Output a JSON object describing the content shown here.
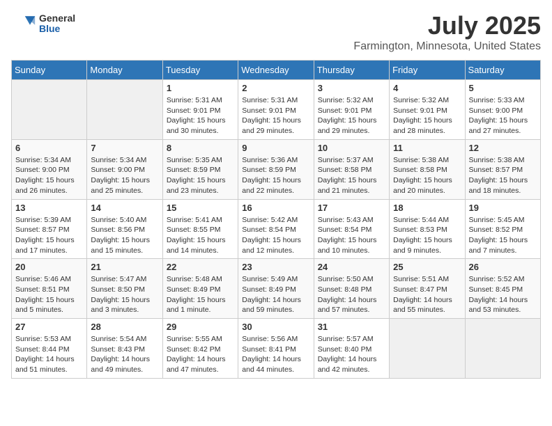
{
  "header": {
    "logo_general": "General",
    "logo_blue": "Blue",
    "title": "July 2025",
    "subtitle": "Farmington, Minnesota, United States"
  },
  "calendar": {
    "days_of_week": [
      "Sunday",
      "Monday",
      "Tuesday",
      "Wednesday",
      "Thursday",
      "Friday",
      "Saturday"
    ],
    "weeks": [
      [
        {
          "day": "",
          "info": ""
        },
        {
          "day": "",
          "info": ""
        },
        {
          "day": "1",
          "info": "Sunrise: 5:31 AM\nSunset: 9:01 PM\nDaylight: 15 hours\nand 30 minutes."
        },
        {
          "day": "2",
          "info": "Sunrise: 5:31 AM\nSunset: 9:01 PM\nDaylight: 15 hours\nand 29 minutes."
        },
        {
          "day": "3",
          "info": "Sunrise: 5:32 AM\nSunset: 9:01 PM\nDaylight: 15 hours\nand 29 minutes."
        },
        {
          "day": "4",
          "info": "Sunrise: 5:32 AM\nSunset: 9:01 PM\nDaylight: 15 hours\nand 28 minutes."
        },
        {
          "day": "5",
          "info": "Sunrise: 5:33 AM\nSunset: 9:00 PM\nDaylight: 15 hours\nand 27 minutes."
        }
      ],
      [
        {
          "day": "6",
          "info": "Sunrise: 5:34 AM\nSunset: 9:00 PM\nDaylight: 15 hours\nand 26 minutes."
        },
        {
          "day": "7",
          "info": "Sunrise: 5:34 AM\nSunset: 9:00 PM\nDaylight: 15 hours\nand 25 minutes."
        },
        {
          "day": "8",
          "info": "Sunrise: 5:35 AM\nSunset: 8:59 PM\nDaylight: 15 hours\nand 23 minutes."
        },
        {
          "day": "9",
          "info": "Sunrise: 5:36 AM\nSunset: 8:59 PM\nDaylight: 15 hours\nand 22 minutes."
        },
        {
          "day": "10",
          "info": "Sunrise: 5:37 AM\nSunset: 8:58 PM\nDaylight: 15 hours\nand 21 minutes."
        },
        {
          "day": "11",
          "info": "Sunrise: 5:38 AM\nSunset: 8:58 PM\nDaylight: 15 hours\nand 20 minutes."
        },
        {
          "day": "12",
          "info": "Sunrise: 5:38 AM\nSunset: 8:57 PM\nDaylight: 15 hours\nand 18 minutes."
        }
      ],
      [
        {
          "day": "13",
          "info": "Sunrise: 5:39 AM\nSunset: 8:57 PM\nDaylight: 15 hours\nand 17 minutes."
        },
        {
          "day": "14",
          "info": "Sunrise: 5:40 AM\nSunset: 8:56 PM\nDaylight: 15 hours\nand 15 minutes."
        },
        {
          "day": "15",
          "info": "Sunrise: 5:41 AM\nSunset: 8:55 PM\nDaylight: 15 hours\nand 14 minutes."
        },
        {
          "day": "16",
          "info": "Sunrise: 5:42 AM\nSunset: 8:54 PM\nDaylight: 15 hours\nand 12 minutes."
        },
        {
          "day": "17",
          "info": "Sunrise: 5:43 AM\nSunset: 8:54 PM\nDaylight: 15 hours\nand 10 minutes."
        },
        {
          "day": "18",
          "info": "Sunrise: 5:44 AM\nSunset: 8:53 PM\nDaylight: 15 hours\nand 9 minutes."
        },
        {
          "day": "19",
          "info": "Sunrise: 5:45 AM\nSunset: 8:52 PM\nDaylight: 15 hours\nand 7 minutes."
        }
      ],
      [
        {
          "day": "20",
          "info": "Sunrise: 5:46 AM\nSunset: 8:51 PM\nDaylight: 15 hours\nand 5 minutes."
        },
        {
          "day": "21",
          "info": "Sunrise: 5:47 AM\nSunset: 8:50 PM\nDaylight: 15 hours\nand 3 minutes."
        },
        {
          "day": "22",
          "info": "Sunrise: 5:48 AM\nSunset: 8:49 PM\nDaylight: 15 hours\nand 1 minute."
        },
        {
          "day": "23",
          "info": "Sunrise: 5:49 AM\nSunset: 8:49 PM\nDaylight: 14 hours\nand 59 minutes."
        },
        {
          "day": "24",
          "info": "Sunrise: 5:50 AM\nSunset: 8:48 PM\nDaylight: 14 hours\nand 57 minutes."
        },
        {
          "day": "25",
          "info": "Sunrise: 5:51 AM\nSunset: 8:47 PM\nDaylight: 14 hours\nand 55 minutes."
        },
        {
          "day": "26",
          "info": "Sunrise: 5:52 AM\nSunset: 8:45 PM\nDaylight: 14 hours\nand 53 minutes."
        }
      ],
      [
        {
          "day": "27",
          "info": "Sunrise: 5:53 AM\nSunset: 8:44 PM\nDaylight: 14 hours\nand 51 minutes."
        },
        {
          "day": "28",
          "info": "Sunrise: 5:54 AM\nSunset: 8:43 PM\nDaylight: 14 hours\nand 49 minutes."
        },
        {
          "day": "29",
          "info": "Sunrise: 5:55 AM\nSunset: 8:42 PM\nDaylight: 14 hours\nand 47 minutes."
        },
        {
          "day": "30",
          "info": "Sunrise: 5:56 AM\nSunset: 8:41 PM\nDaylight: 14 hours\nand 44 minutes."
        },
        {
          "day": "31",
          "info": "Sunrise: 5:57 AM\nSunset: 8:40 PM\nDaylight: 14 hours\nand 42 minutes."
        },
        {
          "day": "",
          "info": ""
        },
        {
          "day": "",
          "info": ""
        }
      ]
    ]
  }
}
